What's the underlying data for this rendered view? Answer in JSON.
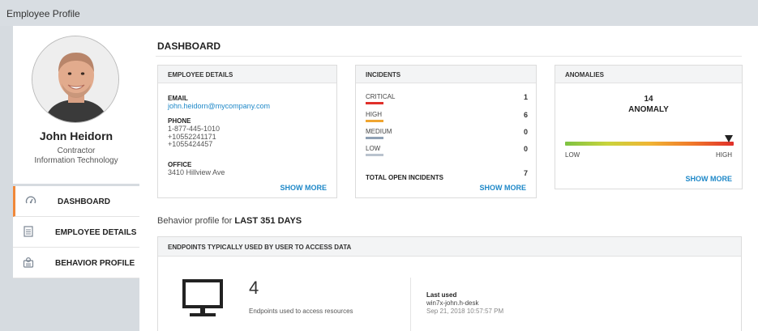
{
  "window": {
    "title": "Employee Profile"
  },
  "profile": {
    "name": "John Heidorn",
    "role": "Contractor",
    "department": "Information Technology"
  },
  "nav": {
    "items": [
      {
        "label": "DASHBOARD",
        "icon": "gauge-icon",
        "active": true
      },
      {
        "label": "EMPLOYEE DETAILS",
        "icon": "document-icon",
        "active": false
      },
      {
        "label": "BEHAVIOR PROFILE",
        "icon": "profile-icon",
        "active": false
      }
    ]
  },
  "dashboard": {
    "title": "DASHBOARD"
  },
  "employee_details": {
    "title": "EMPLOYEE DETAILS",
    "email_label": "EMAIL",
    "email": "john.heidorn@mycompany.com",
    "phone_label": "PHONE",
    "phones": [
      "1-877-445-1010",
      "+10552241171",
      "+1055424457"
    ],
    "office_label": "OFFICE",
    "office": "3410 Hillview Ave",
    "show_more": "SHOW MORE"
  },
  "incidents": {
    "title": "INCIDENTS",
    "rows": [
      {
        "name": "CRITICAL",
        "count": "1",
        "color": "#e0302a"
      },
      {
        "name": "HIGH",
        "count": "6",
        "color": "#f0a530"
      },
      {
        "name": "MEDIUM",
        "count": "0",
        "color": "#8fa0b4"
      },
      {
        "name": "LOW",
        "count": "0",
        "color": "#b9c3ce"
      }
    ],
    "total_label": "TOTAL OPEN INCIDENTS",
    "total": "7",
    "show_more": "SHOW MORE"
  },
  "anomalies": {
    "title": "ANOMALIES",
    "count": "14",
    "label": "ANOMALY",
    "level_fraction": 0.97,
    "low_label": "LOW",
    "high_label": "HIGH",
    "show_more": "SHOW MORE"
  },
  "behavior": {
    "prefix": "Behavior profile for",
    "period": "LAST 351 DAYS"
  },
  "endpoints": {
    "title": "ENDPOINTS TYPICALLY USED BY USER TO ACCESS DATA",
    "count": "4",
    "description": "Endpoints used to access resources",
    "last_used_label": "Last used",
    "last_used_host": "win7x-john.h-desk",
    "last_used_time": "Sep 21, 2018 10:57:57 PM"
  }
}
